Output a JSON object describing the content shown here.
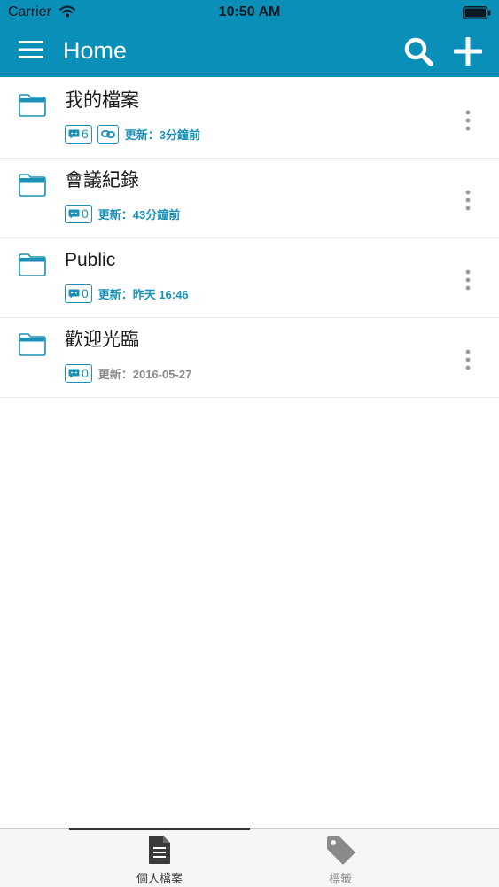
{
  "status_bar": {
    "carrier": "Carrier",
    "time": "10:50 AM"
  },
  "header": {
    "title": "Home",
    "color": "#0a8fb9",
    "menu_icon": "menu-icon",
    "search_icon": "search-icon",
    "add_icon": "add-icon"
  },
  "files": [
    {
      "name": "我的檔案",
      "comment_count": "6",
      "shared_link": true,
      "updated": "更新：3分鐘前",
      "recent": true
    },
    {
      "name": "會議紀錄",
      "comment_count": "0",
      "shared_link": false,
      "updated": "更新：43分鐘前",
      "recent": true
    },
    {
      "name": "Public",
      "comment_count": "0",
      "shared_link": false,
      "updated": "更新：昨天 16:46",
      "recent": true
    },
    {
      "name": "歡迎光臨",
      "comment_count": "0",
      "shared_link": false,
      "updated": "更新：2016-05-27",
      "recent": false
    }
  ],
  "tab_bar": {
    "tabs": [
      {
        "label": "個人檔案",
        "icon": "document-icon",
        "active": true
      },
      {
        "label": "標籤",
        "icon": "tag-icon",
        "active": false
      }
    ]
  },
  "colors": {
    "accent": "#1b91b8",
    "muted": "#8a8a8a"
  }
}
